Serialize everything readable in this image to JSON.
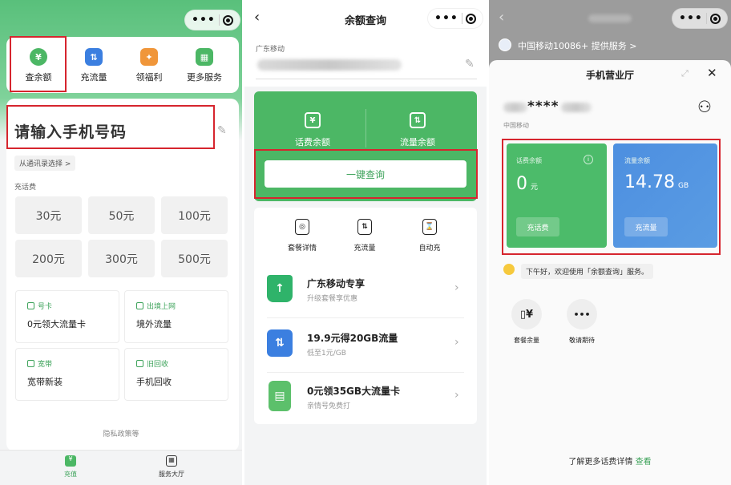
{
  "colors": {
    "brand_green": "#4cb765",
    "highlight_red": "#d6252e",
    "flow_blue": "#4a8fd8"
  },
  "panel1": {
    "quick_actions": [
      {
        "label": "查余额",
        "icon": "yen-search-icon"
      },
      {
        "label": "充流量",
        "icon": "data-swap-icon"
      },
      {
        "label": "领福利",
        "icon": "gift-icon"
      },
      {
        "label": "更多服务",
        "icon": "grid-icon"
      }
    ],
    "phone_placeholder": "请输入手机号码",
    "contacts_link": "从通讯录选择 >",
    "recharge_title": "充话费",
    "amounts": [
      "30元",
      "50元",
      "100元",
      "200元",
      "300元",
      "500元"
    ],
    "services": [
      {
        "tag": "号卡",
        "text": "0元领大流量卡"
      },
      {
        "tag": "出境上网",
        "text": "境外流量"
      },
      {
        "tag": "宽带",
        "text": "宽带新装"
      },
      {
        "tag": "旧回收",
        "text": "手机回收"
      }
    ],
    "privacy": "隐私政策等",
    "tabs": [
      {
        "label": "充值"
      },
      {
        "label": "服务大厅"
      }
    ]
  },
  "panel2": {
    "title": "余额查询",
    "carrier": "广东移动",
    "balance_items": [
      {
        "label": "话费余额"
      },
      {
        "label": "流量余额"
      }
    ],
    "query_button": "一键查询",
    "shortcuts": [
      {
        "label": "套餐详情"
      },
      {
        "label": "充流量"
      },
      {
        "label": "自动充"
      }
    ],
    "promos": [
      {
        "title": "广东移动专享",
        "sub": "升级套餐享优惠"
      },
      {
        "title": "19.9元得20GB流量",
        "sub": "低至1元/GB"
      },
      {
        "title": "0元领35GB大流量卡",
        "sub": "亲情号免费打"
      }
    ]
  },
  "panel3": {
    "provider": "中国移动10086+ 提供服务 >",
    "sheet_title": "手机营业厅",
    "masked_number": "****",
    "carrier": "中国移动",
    "call_balance_label": "话费余额",
    "call_balance_value": "0",
    "call_balance_unit": "元",
    "call_button": "充话费",
    "data_balance_label": "流量余额",
    "data_balance_value": "14.78",
    "data_balance_unit": "GB",
    "data_button": "充流量",
    "greeting": "下午好，欢迎使用「余额查询」服务。",
    "actions": [
      {
        "label": "套餐余量"
      },
      {
        "label": "敬请期待"
      }
    ],
    "footer_text": "了解更多话费详情",
    "footer_link": "查看"
  }
}
